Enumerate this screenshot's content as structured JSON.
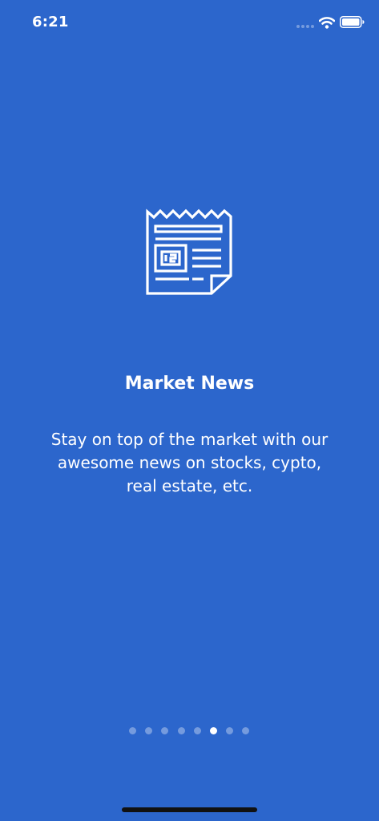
{
  "status_bar": {
    "time": "6:21",
    "icons": [
      "signal-dots-icon",
      "wifi-icon",
      "battery-icon"
    ]
  },
  "onboarding": {
    "icon": "newspaper-icon",
    "title": "Market News",
    "description": "Stay on top of the market with our\nawesome news on stocks, cypto,\nreal estate, etc."
  },
  "pager": {
    "page_count": 8,
    "current_page": 6
  },
  "colors": {
    "background": "#2C66CC",
    "foreground": "#FFFFFF",
    "inactive_dot": "rgba(255,255,255,0.35)",
    "home_indicator": "#111111"
  }
}
